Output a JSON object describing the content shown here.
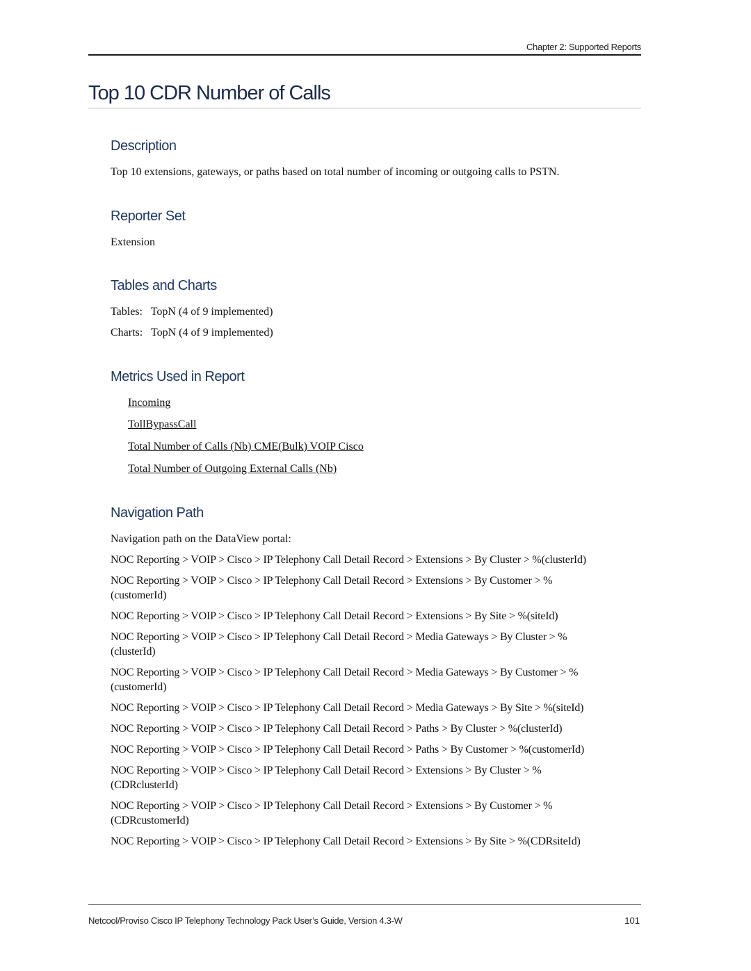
{
  "header": {
    "chapter": "Chapter 2: Supported Reports"
  },
  "title": "Top 10 CDR Number of Calls",
  "sections": {
    "description": {
      "heading": "Description",
      "text": "Top 10 extensions, gateways, or paths based on total number of incoming or outgoing calls to PSTN."
    },
    "reporter_set": {
      "heading": "Reporter Set",
      "text": "Extension"
    },
    "tables_charts": {
      "heading": "Tables and Charts",
      "tables": "Tables:   TopN (4 of 9 implemented)",
      "charts": "Charts:   TopN (4 of 9 implemented)"
    },
    "metrics": {
      "heading": "Metrics Used in Report",
      "items": [
        "Incoming",
        "TollBypassCall",
        "Total Number of Calls (Nb) CME(Bulk) VOIP Cisco",
        "Total Number of Outgoing External Calls (Nb)"
      ]
    },
    "navigation": {
      "heading": "Navigation Path",
      "intro": "Navigation path on the DataView portal:",
      "paths": [
        "NOC Reporting > VOIP > Cisco > IP Telephony Call Detail Record > Extensions > By Cluster > %(clusterId)",
        "NOC Reporting > VOIP > Cisco > IP Telephony Call Detail Record > Extensions > By Customer > %(customerId)",
        "NOC Reporting > VOIP > Cisco > IP Telephony Call Detail Record > Extensions > By Site > %(siteId)",
        "NOC Reporting > VOIP > Cisco > IP Telephony Call Detail Record > Media Gateways > By Cluster > %(clusterId)",
        "NOC Reporting > VOIP > Cisco > IP Telephony Call Detail Record > Media Gateways > By Customer > %(customerId)",
        "NOC Reporting > VOIP > Cisco > IP Telephony Call Detail Record > Media Gateways > By Site > %(siteId)",
        "NOC Reporting > VOIP > Cisco > IP Telephony Call Detail Record > Paths > By Cluster > %(clusterId)",
        "NOC Reporting > VOIP > Cisco > IP Telephony Call Detail Record > Paths > By Customer > %(customerId)",
        "NOC Reporting > VOIP > Cisco > IP Telephony Call Detail Record > Extensions > By Cluster > %(CDRclusterId)",
        "NOC Reporting > VOIP > Cisco > IP Telephony Call Detail Record > Extensions > By Customer > %(CDRcustomerId)",
        "NOC Reporting > VOIP > Cisco > IP Telephony Call Detail Record > Extensions > By Site > %(CDRsiteId)"
      ]
    }
  },
  "footer": {
    "text": "Netcool/Proviso Cisco IP Telephony Technology Pack User’s Guide, Version 4.3-W",
    "page_number": "101"
  }
}
